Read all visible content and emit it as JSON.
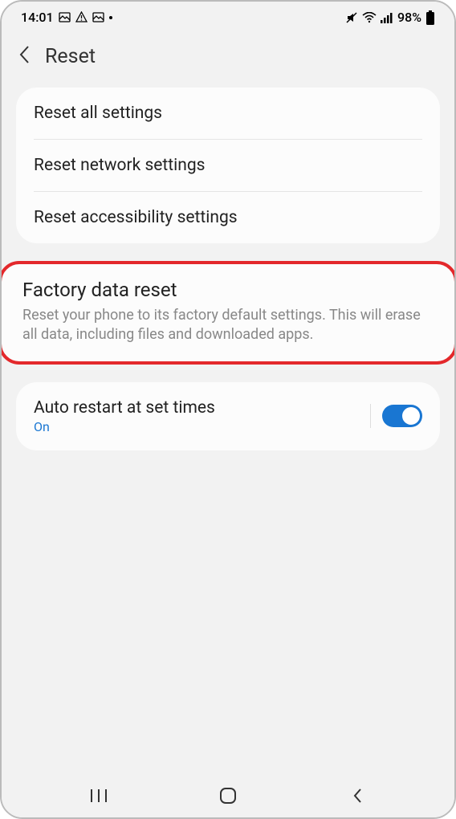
{
  "statusBar": {
    "time": "14:01",
    "battery": "98%"
  },
  "header": {
    "title": "Reset"
  },
  "list": {
    "item1": "Reset all settings",
    "item2": "Reset network settings",
    "item3": "Reset accessibility settings"
  },
  "factory": {
    "title": "Factory data reset",
    "description": "Reset your phone to its factory default settings. This will erase all data, including files and downloaded apps."
  },
  "autoRestart": {
    "title": "Auto restart at set times",
    "status": "On"
  }
}
